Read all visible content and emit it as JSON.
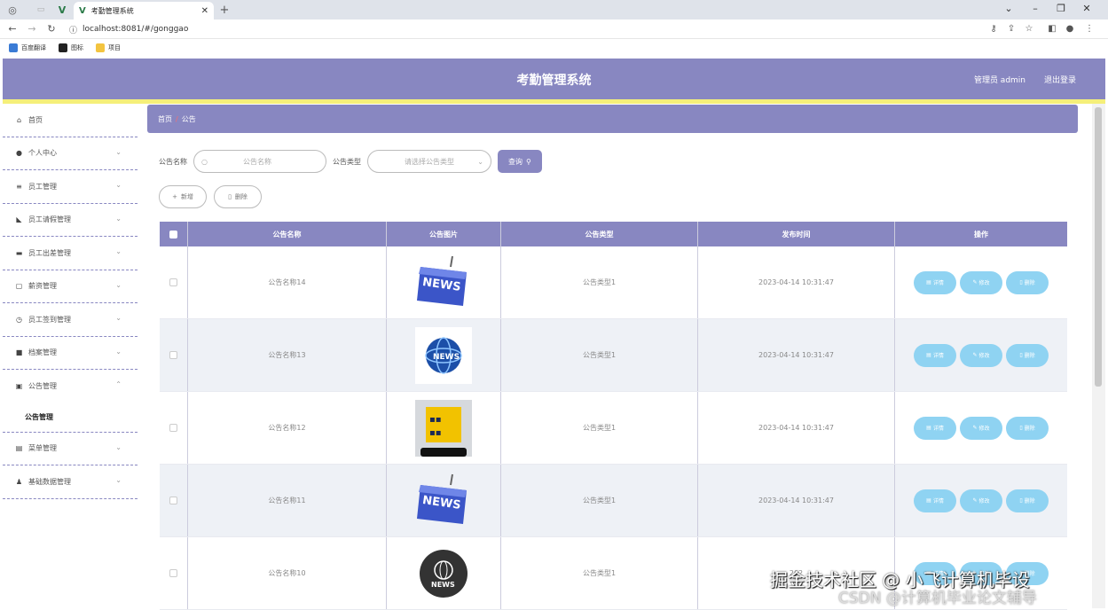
{
  "browser": {
    "tab_title": "考勤管理系统",
    "url": "localhost:8081/#/gonggao",
    "bookmarks": [
      "百度翻译",
      "图标",
      "项目"
    ]
  },
  "header": {
    "title": "考勤管理系统",
    "user": "管理员 admin",
    "logout": "退出登录"
  },
  "sidebar": {
    "items": [
      {
        "label": "首页",
        "icon": "home-icon"
      },
      {
        "label": "个人中心",
        "icon": "user-icon"
      },
      {
        "label": "员工管理",
        "icon": "list-icon"
      },
      {
        "label": "员工请假管理",
        "icon": "hand-icon"
      },
      {
        "label": "员工出差管理",
        "icon": "monitor-icon"
      },
      {
        "label": "薪资管理",
        "icon": "chat-icon"
      },
      {
        "label": "员工签到管理",
        "icon": "clock-icon"
      },
      {
        "label": "档案管理",
        "icon": "doc-icon"
      },
      {
        "label": "公告管理",
        "icon": "ticket-icon"
      },
      {
        "label": "菜单管理",
        "icon": "printer-icon"
      },
      {
        "label": "基础数据管理",
        "icon": "person-icon"
      }
    ],
    "submenu": "公告管理"
  },
  "breadcrumb": {
    "home": "首页",
    "sep": "/",
    "current": "公告"
  },
  "search": {
    "name_label": "公告名称",
    "name_placeholder": "公告名称",
    "type_label": "公告类型",
    "type_placeholder": "请选择公告类型",
    "query_button": "查询"
  },
  "actions": {
    "add": "新增",
    "delete": "删除"
  },
  "table": {
    "headers": [
      "公告名称",
      "公告图片",
      "公告类型",
      "发布时间",
      "操作"
    ],
    "row_buttons": {
      "detail": "详情",
      "edit": "修改",
      "delete": "删除"
    },
    "rows": [
      {
        "name": "公告名称14",
        "type": "公告类型1",
        "time": "2023-04-14 10:31:47",
        "image": "news-keyboard"
      },
      {
        "name": "公告名称13",
        "type": "公告类型1",
        "time": "2023-04-14 10:31:47",
        "image": "news-globe"
      },
      {
        "name": "公告名称12",
        "type": "公告类型1",
        "time": "2023-04-14 10:31:47",
        "image": "news-phone"
      },
      {
        "name": "公告名称11",
        "type": "公告类型1",
        "time": "2023-04-14 10:31:47",
        "image": "news-keyboard"
      },
      {
        "name": "公告名称10",
        "type": "公告类型1",
        "time": "202",
        "image": "news-circle"
      }
    ]
  },
  "watermark": {
    "line1": "掘金技术社区 @ 小飞计算机毕设",
    "line2": "CSDN @计算机毕业论文辅导"
  },
  "colors": {
    "accent": "#8887c1",
    "yellow": "#f5ef7a",
    "action": "#8fd3f2"
  }
}
